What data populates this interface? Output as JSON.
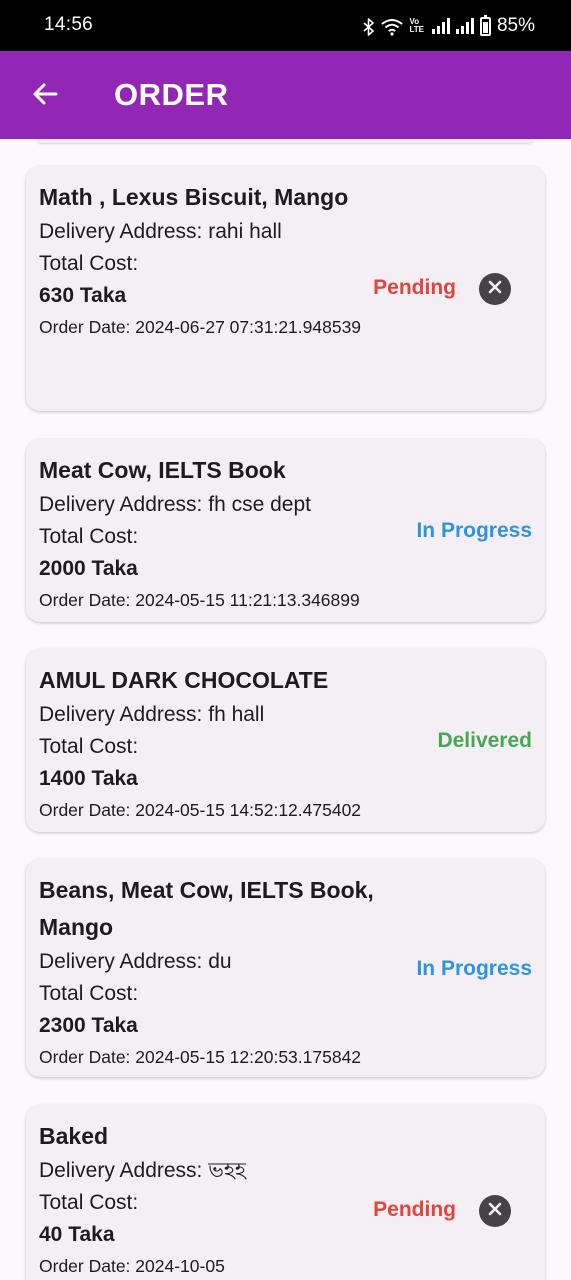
{
  "status_bar": {
    "time": "14:56",
    "volte_top": "Vo",
    "volte_bottom": "LTE",
    "battery": "85%"
  },
  "app_bar": {
    "title": "ORDER",
    "back_icon": "arrow-back-icon"
  },
  "orders": [
    {
      "items": "Math , Lexus  Biscuit, Mango",
      "address": "Delivery Address: rahi hall",
      "cost_label": "Total Cost:",
      "cost": "630 Taka",
      "date": "Order Date: 2024-06-27 07:31:21.948539",
      "status": "Pending",
      "cancelable": true
    },
    {
      "items": "Meat Cow, IELTS Book",
      "address": "Delivery Address: fh cse dept",
      "cost_label": "Total Cost:",
      "cost": "2000 Taka",
      "date": "Order Date: 2024-05-15 11:21:13.346899",
      "status": "In Progress",
      "cancelable": false
    },
    {
      "items": "AMUL DARK CHOCOLATE",
      "address": "Delivery Address: fh hall",
      "cost_label": "Total Cost:",
      "cost": "1400 Taka",
      "date": "Order Date: 2024-05-15 14:52:12.475402",
      "status": "Delivered",
      "cancelable": false
    },
    {
      "items": "Beans, Meat Cow, IELTS Book, Mango",
      "address": "Delivery Address: du",
      "cost_label": "Total Cost:",
      "cost": "2300 Taka",
      "date": "Order Date: 2024-05-15 12:20:53.175842",
      "status": "In Progress",
      "cancelable": false
    },
    {
      "items": "Baked",
      "address": "Delivery Address: ভহহ",
      "cost_label": "Total Cost:",
      "cost": "40 Taka",
      "date": "Order Date: 2024-10-05",
      "status": "Pending",
      "cancelable": true
    }
  ],
  "colors": {
    "app_bar": "#9226b5",
    "pending": "#e2453c",
    "in_progress": "#2e95dc",
    "delivered": "#46a94f",
    "card": "#f4eff5",
    "cancel_icon": "#464348"
  }
}
